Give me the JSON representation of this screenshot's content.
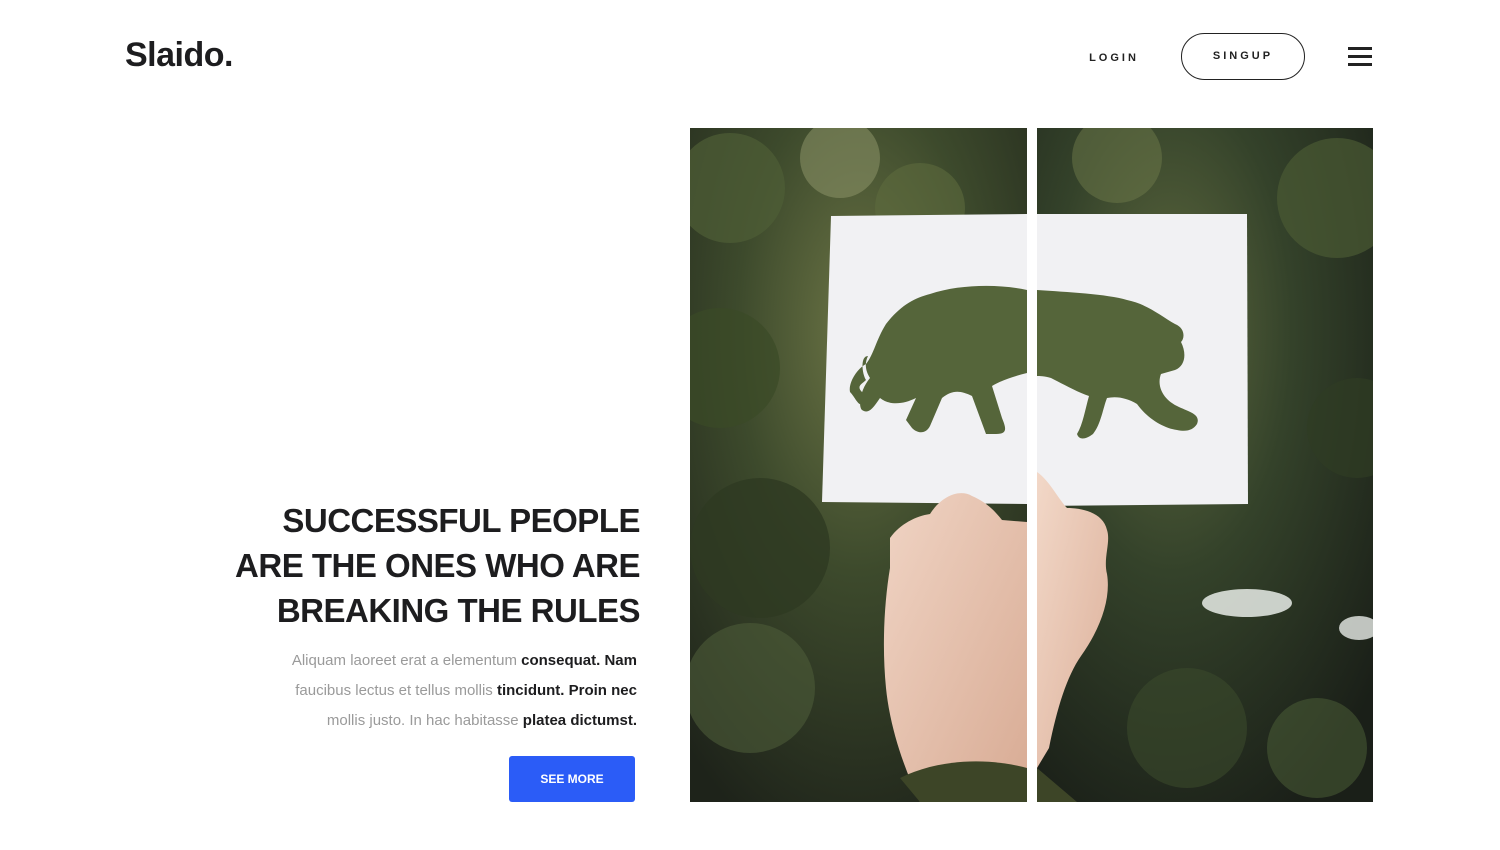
{
  "header": {
    "logo": "Slaido.",
    "login_label": "LOGIN",
    "signup_label": "SINGUP",
    "menu_icon": "hamburger-menu-icon"
  },
  "hero": {
    "title_lines": [
      "SUCCESSFUL PEOPLE",
      "ARE THE ONES WHO ARE",
      "BREAKING THE RULES"
    ],
    "paragraph": [
      {
        "muted": "Aliquam laoreet erat a elementum",
        "strong": "consequat. Nam"
      },
      {
        "muted": "faucibus lectus et tellus mollis",
        "strong": "tincidunt. Proin nec"
      },
      {
        "muted": "mollis justo. In hac habitasse",
        "strong": "platea dictumst."
      }
    ],
    "button_label": "SEE MORE"
  },
  "image": {
    "subject": "hand-holding-paper-cutout-panther-split-photo"
  },
  "colors": {
    "accent": "#2b5cf7",
    "text_dark": "#1d1d1f",
    "text_muted": "#9a9a9a",
    "background": "#ffffff"
  }
}
